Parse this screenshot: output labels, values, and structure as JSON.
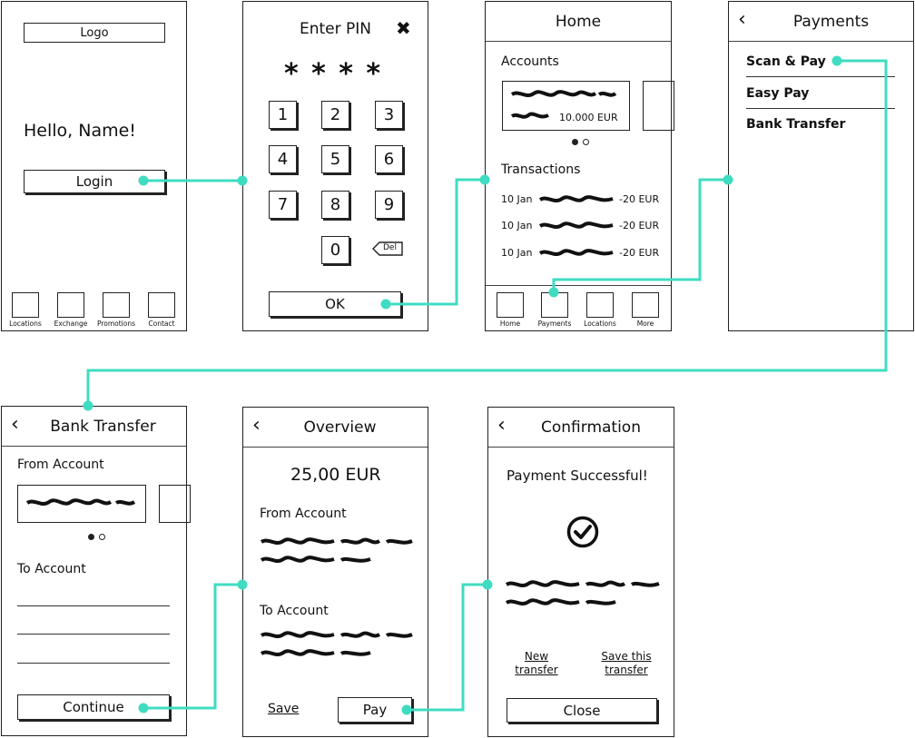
{
  "colors": {
    "connector": "#3fdcc2",
    "ink": "#222222"
  },
  "login": {
    "logo": "Logo",
    "greeting": "Hello, Name!",
    "login_button": "Login",
    "nav": [
      "Locations",
      "Exchange",
      "Promotions",
      "Contact"
    ]
  },
  "pin": {
    "title": "Enter PIN",
    "masked": "* * * *",
    "keys": [
      "1",
      "2",
      "3",
      "4",
      "5",
      "6",
      "7",
      "8",
      "9",
      "0"
    ],
    "del": "Del",
    "ok": "OK"
  },
  "home": {
    "title": "Home",
    "accounts": "Accounts",
    "balance": "10.000 EUR",
    "transactions": "Transactions",
    "rows": [
      {
        "date": "10 Jan",
        "amount": "-20 EUR"
      },
      {
        "date": "10 Jan",
        "amount": "-20 EUR"
      },
      {
        "date": "10 Jan",
        "amount": "-20 EUR"
      }
    ],
    "nav": [
      "Home",
      "Payments",
      "Locations",
      "More"
    ]
  },
  "payments": {
    "title": "Payments",
    "items": [
      "Scan & Pay",
      "Easy Pay",
      "Bank Transfer"
    ]
  },
  "transfer": {
    "title": "Bank Transfer",
    "from": "From Account",
    "to": "To Account",
    "continue": "Continue"
  },
  "overview": {
    "title": "Overview",
    "amount": "25,00 EUR",
    "from": "From Account",
    "to": "To Account",
    "save": "Save",
    "pay": "Pay"
  },
  "confirm": {
    "title": "Confirmation",
    "message": "Payment Successful!",
    "new_transfer": "New transfer",
    "save_transfer": "Save this transfer",
    "close": "Close"
  }
}
